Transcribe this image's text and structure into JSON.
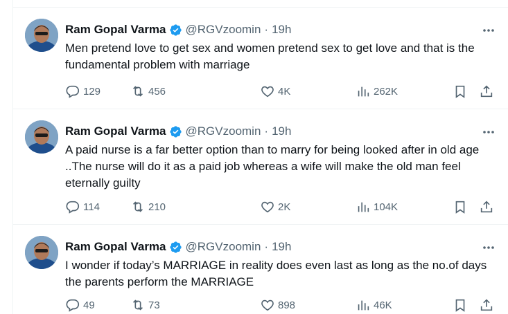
{
  "tweets": [
    {
      "author_name": "Ram Gopal Varma",
      "handle": "@RGVzoomin",
      "separator": "·",
      "time": "19h",
      "text": "Men pretend love to get sex and women pretend sex to get love and that is the fundamental problem with marriage",
      "replies": "129",
      "reposts": "456",
      "likes": "4K",
      "views": "262K"
    },
    {
      "author_name": "Ram Gopal Varma",
      "handle": "@RGVzoomin",
      "separator": "·",
      "time": "19h",
      "text": "A paid nurse is a far better option than to marry for being looked after in old age ..The nurse will do it as a paid job whereas a wife will make the old man feel eternally guilty",
      "replies": "114",
      "reposts": "210",
      "likes": "2K",
      "views": "104K"
    },
    {
      "author_name": "Ram Gopal Varma",
      "handle": "@RGVzoomin",
      "separator": "·",
      "time": "19h",
      "text": "I wonder if today’s MARRIAGE in reality does even last as long as the no.of days the parents perform the MARRIAGE",
      "replies": "49",
      "reposts": "73",
      "likes": "898",
      "views": "46K"
    }
  ],
  "colors": {
    "verified_blue": "#1d9bf0",
    "secondary_text": "#536471",
    "divider": "#eff3f4"
  },
  "icons": [
    "avatar",
    "verified-badge-icon",
    "more-icon",
    "reply-icon",
    "repost-icon",
    "like-icon",
    "views-icon",
    "bookmark-icon",
    "share-icon"
  ]
}
